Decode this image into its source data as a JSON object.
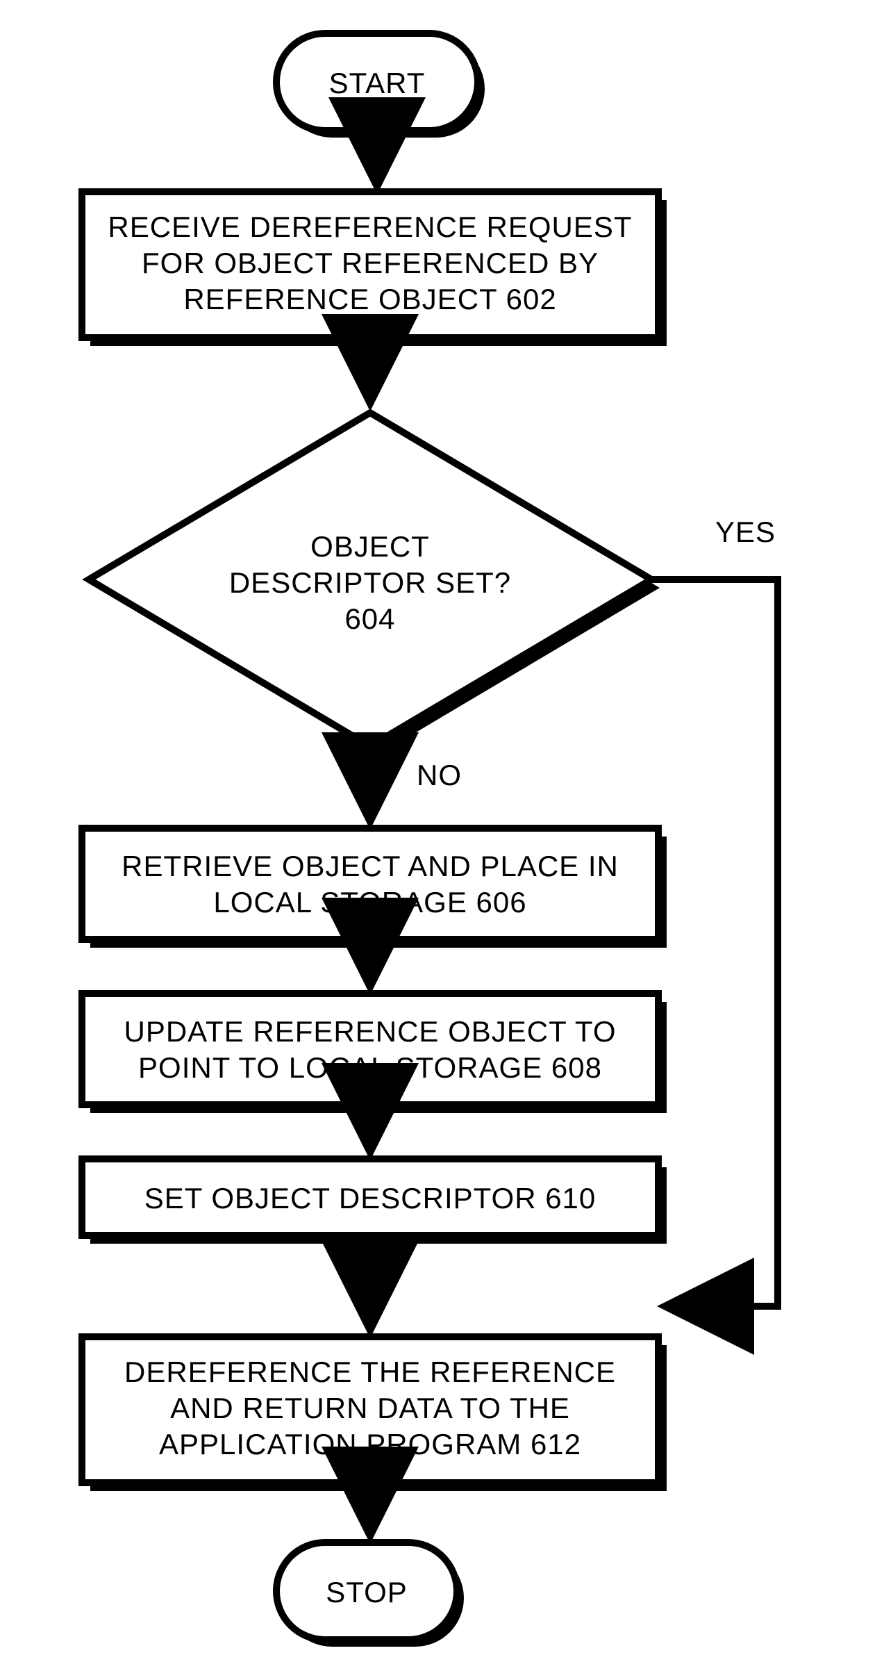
{
  "chart_data": {
    "type": "flowchart",
    "nodes": [
      {
        "id": "start",
        "shape": "terminator",
        "label": "START"
      },
      {
        "id": "n602",
        "shape": "process",
        "lines": [
          "RECEIVE DEREFERENCE REQUEST",
          "FOR OBJECT REFERENCED BY",
          "REFERENCE OBJECT 602"
        ]
      },
      {
        "id": "n604",
        "shape": "decision",
        "lines": [
          "OBJECT",
          "DESCRIPTOR SET?",
          "604"
        ]
      },
      {
        "id": "n606",
        "shape": "process",
        "lines": [
          "RETRIEVE OBJECT AND PLACE IN",
          "LOCAL STORAGE 606"
        ]
      },
      {
        "id": "n608",
        "shape": "process",
        "lines": [
          "UPDATE REFERENCE OBJECT TO",
          "POINT TO LOCAL STORAGE 608"
        ]
      },
      {
        "id": "n610",
        "shape": "process",
        "lines": [
          "SET OBJECT DESCRIPTOR 610"
        ]
      },
      {
        "id": "n612",
        "shape": "process",
        "lines": [
          "DEREFERENCE THE REFERENCE",
          "AND RETURN DATA TO THE",
          "APPLICATION PROGRAM 612"
        ]
      },
      {
        "id": "stop",
        "shape": "terminator",
        "label": "STOP"
      }
    ],
    "edges": [
      {
        "from": "start",
        "to": "n602"
      },
      {
        "from": "n602",
        "to": "n604"
      },
      {
        "from": "n604",
        "to": "n606",
        "label": "NO"
      },
      {
        "from": "n604",
        "to": "n612",
        "label": "YES",
        "path": "right-down"
      },
      {
        "from": "n606",
        "to": "n608"
      },
      {
        "from": "n608",
        "to": "n610"
      },
      {
        "from": "n610",
        "to": "n612"
      },
      {
        "from": "n612",
        "to": "stop"
      }
    ]
  },
  "labels": {
    "start": "START",
    "stop": "STOP",
    "no": "NO",
    "yes": "YES",
    "n602_l1": "RECEIVE DEREFERENCE REQUEST",
    "n602_l2": "FOR OBJECT REFERENCED BY",
    "n602_l3": "REFERENCE OBJECT 602",
    "n604_l1": "OBJECT",
    "n604_l2": "DESCRIPTOR SET?",
    "n604_l3": "604",
    "n606_l1": "RETRIEVE OBJECT AND PLACE IN",
    "n606_l2": "LOCAL STORAGE 606",
    "n608_l1": "UPDATE REFERENCE OBJECT TO",
    "n608_l2": "POINT TO LOCAL STORAGE 608",
    "n610_l1": "SET OBJECT DESCRIPTOR 610",
    "n612_l1": "DEREFERENCE THE REFERENCE",
    "n612_l2": "AND RETURN DATA TO THE",
    "n612_l3": "APPLICATION PROGRAM 612"
  }
}
